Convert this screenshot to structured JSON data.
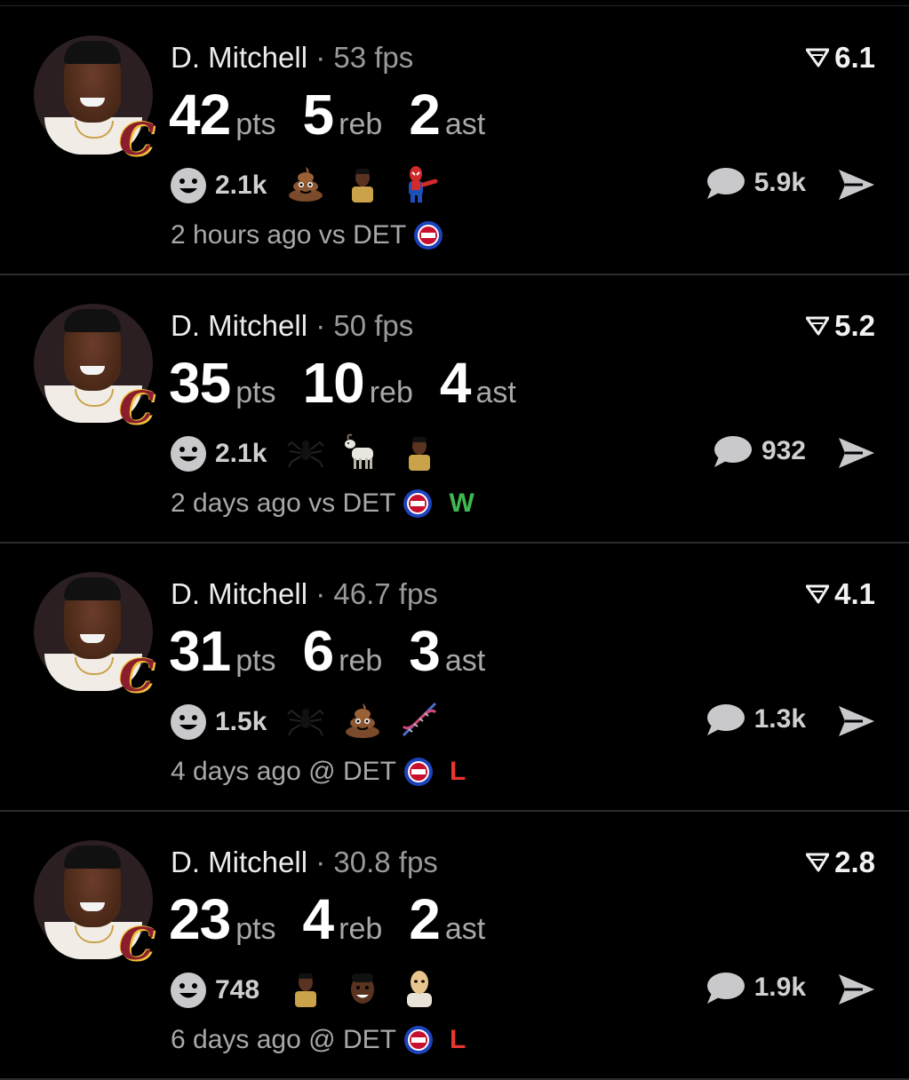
{
  "colors": {
    "win": "#3fb950",
    "loss": "#e5372e",
    "background": "#000000",
    "muted": "#a8a8a8"
  },
  "cards": [
    {
      "player": "D. Mitchell",
      "sep": "·",
      "fps": "53 fps",
      "rating": "6.1",
      "pts": "42",
      "pts_label": "pts",
      "reb": "5",
      "reb_label": "reb",
      "ast": "2",
      "ast_label": "ast",
      "reactions": "2.1k",
      "reaction_icons": [
        "poop-emoji",
        "player-photo",
        "spider-man-pointing"
      ],
      "comments": "5.9k",
      "when": "2 hours ago",
      "venue": "vs",
      "opponent": "DET",
      "result": ""
    },
    {
      "player": "D. Mitchell",
      "sep": "·",
      "fps": "50 fps",
      "rating": "5.2",
      "pts": "35",
      "pts_label": "pts",
      "reb": "10",
      "reb_label": "reb",
      "ast": "4",
      "ast_label": "ast",
      "reactions": "2.1k",
      "reaction_icons": [
        "spider-emoji",
        "goat-emoji",
        "player-photo"
      ],
      "comments": "932",
      "when": "2 days ago",
      "venue": "vs",
      "opponent": "DET",
      "result": "W"
    },
    {
      "player": "D. Mitchell",
      "sep": "·",
      "fps": "46.7 fps",
      "rating": "4.1",
      "pts": "31",
      "pts_label": "pts",
      "reb": "6",
      "reb_label": "reb",
      "ast": "3",
      "ast_label": "ast",
      "reactions": "1.5k",
      "reaction_icons": [
        "spider-emoji",
        "poop-emoji",
        "dna-emoji"
      ],
      "comments": "1.3k",
      "when": "4 days ago",
      "venue": "@",
      "opponent": "DET",
      "result": "L"
    },
    {
      "player": "D. Mitchell",
      "sep": "·",
      "fps": "30.8 fps",
      "rating": "2.8",
      "pts": "23",
      "pts_label": "pts",
      "reb": "4",
      "reb_label": "reb",
      "ast": "2",
      "ast_label": "ast",
      "reactions": "748",
      "reaction_icons": [
        "player-photo",
        "face-photo",
        "masked-figure"
      ],
      "comments": "1.9k",
      "when": "6 days ago",
      "venue": "@",
      "opponent": "DET",
      "result": "L"
    }
  ]
}
